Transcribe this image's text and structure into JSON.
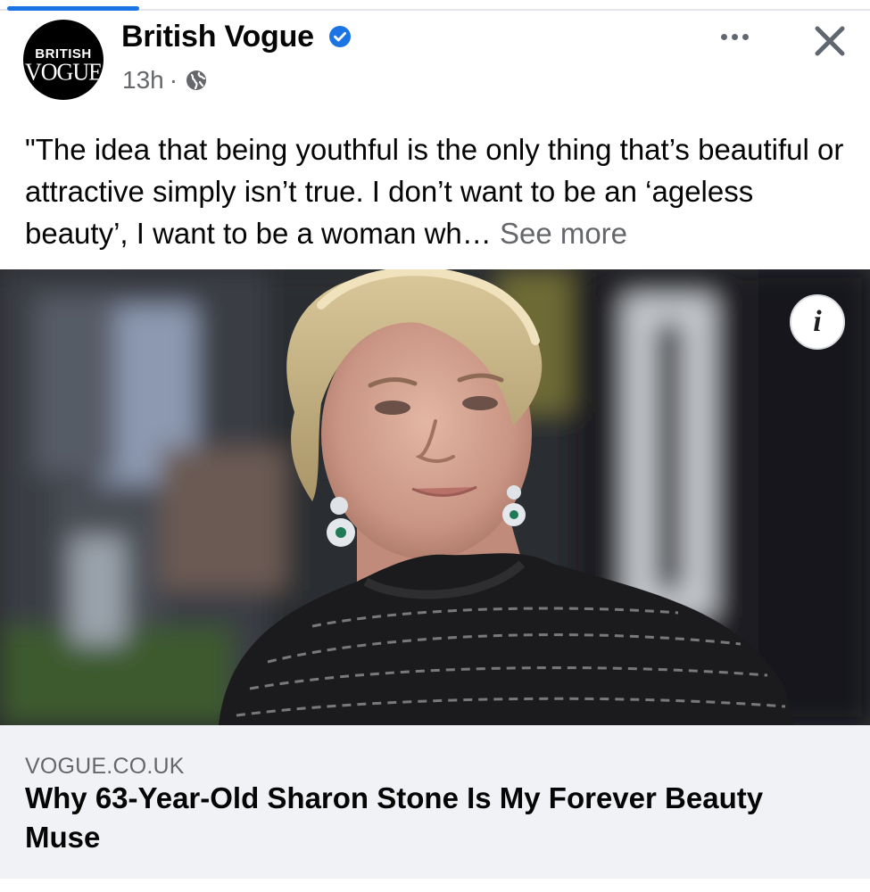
{
  "post": {
    "page_name": "British Vogue",
    "avatar": {
      "line1": "BRITISH",
      "line2": "VOGUE"
    },
    "time": "13h",
    "separator": "·",
    "text": "\"The idea that being youthful is the only thing that’s beautiful or attractive simply isn’t true. I don’t want to be an ‘ageless beauty’, I want to be a woman wh…",
    "see_more": "See more",
    "photo_info_label": "i"
  },
  "link_preview": {
    "domain": "VOGUE.CO.UK",
    "title": "Why 63-Year-Old Sharon Stone Is My Forever Beauty Muse"
  },
  "icons": {
    "verified": "verified-badge-icon",
    "audience": "globe-icon",
    "more": "more-options-icon",
    "close": "close-icon",
    "info": "info-icon"
  },
  "colors": {
    "accent": "#1b74e4",
    "secondary_text": "#65676b",
    "card_background": "#f0f2f5"
  }
}
